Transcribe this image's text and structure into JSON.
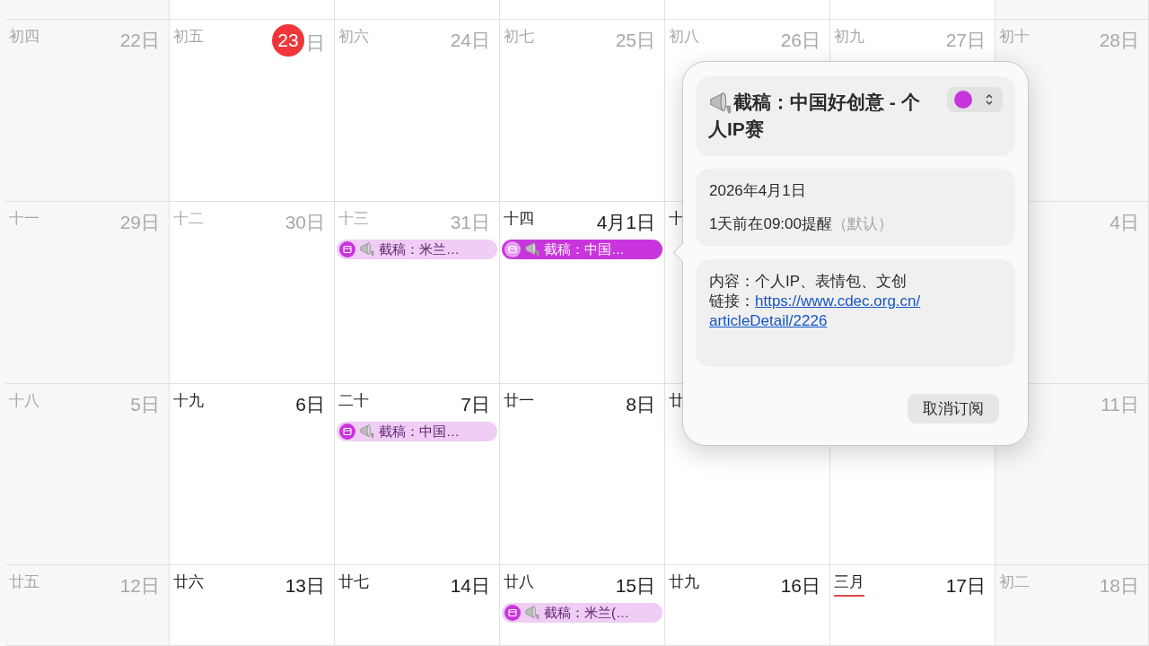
{
  "calendar": {
    "weeks": [
      {
        "days": [
          {
            "lunar": "初四",
            "date": "22日",
            "muted": true
          },
          {
            "lunar": "初五",
            "date": "23",
            "suffix": "日",
            "muted": true,
            "today": true
          },
          {
            "lunar": "初六",
            "date": "24日",
            "muted": true
          },
          {
            "lunar": "初七",
            "date": "25日",
            "muted": true
          },
          {
            "lunar": "初八",
            "date": "26日",
            "muted": true
          },
          {
            "lunar": "初九",
            "date": "27日",
            "muted": true
          },
          {
            "lunar": "初十",
            "date": "28日",
            "muted": true
          }
        ]
      },
      {
        "days": [
          {
            "lunar": "十一",
            "date": "29日",
            "muted": true
          },
          {
            "lunar": "十二",
            "date": "30日",
            "muted": true
          },
          {
            "lunar": "十三",
            "date": "31日",
            "muted": true,
            "events": [
              {
                "title": "截稿：米兰…",
                "selected": false
              }
            ]
          },
          {
            "lunar": "十四",
            "date": "4月1日",
            "muted": false,
            "events": [
              {
                "title": "截稿：中国…",
                "selected": true
              }
            ]
          },
          {
            "lunar": "十",
            "muted": false
          },
          {
            "date": "4日",
            "muted": true
          }
        ]
      },
      {
        "days": [
          {
            "lunar": "十八",
            "date": "5日",
            "muted": true
          },
          {
            "lunar": "十九",
            "date": "6日",
            "muted": false
          },
          {
            "lunar": "二十",
            "date": "7日",
            "muted": false,
            "events": [
              {
                "title": "截稿：中国…",
                "selected": false
              }
            ]
          },
          {
            "lunar": "廿一",
            "date": "8日",
            "muted": false
          },
          {
            "lunar": "廿",
            "muted": false
          },
          {
            "date": "11日",
            "muted": true
          }
        ]
      },
      {
        "days": [
          {
            "lunar": "廿五",
            "date": "12日",
            "muted": true
          },
          {
            "lunar": "廿六",
            "date": "13日",
            "muted": false
          },
          {
            "lunar": "廿七",
            "date": "14日",
            "muted": false
          },
          {
            "lunar": "廿八",
            "date": "15日",
            "muted": false,
            "events": [
              {
                "title": "截稿：米兰(…",
                "selected": false
              }
            ]
          },
          {
            "lunar": "廿九",
            "date": "16日",
            "muted": false
          },
          {
            "lunar": "三月",
            "date": "17日",
            "muted": false,
            "month_start": true
          },
          {
            "lunar": "初二",
            "date": "18日",
            "muted": true
          }
        ]
      }
    ]
  },
  "popover": {
    "title": "截稿：中国好创意 - 个人IP赛",
    "date": "2026年4月1日",
    "alert": "1天前在09:00提醒",
    "alert_hint": "（默认）",
    "notes": [
      {
        "kind": "text",
        "text": "内容：个人IP、表情包、文创"
      },
      {
        "kind": "link",
        "label": "链接：",
        "url": [
          "https://www.cdec.org.cn/",
          "articleDetail/2226"
        ]
      }
    ],
    "button": "取消订阅"
  }
}
